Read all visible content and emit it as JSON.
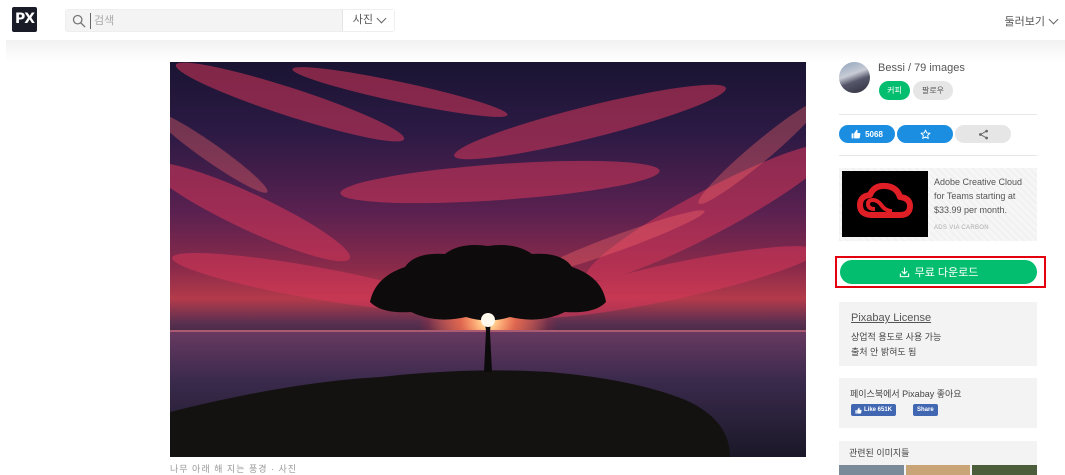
{
  "header": {
    "logo_text": "PX",
    "search_placeholder": "검색",
    "search_type": "사진",
    "explore_label": "둘러보기"
  },
  "photo": {
    "alt": "sunset tree",
    "caption": "나무 아래 해 지는 풍경 · 사진"
  },
  "user": {
    "name": "Bessi / 79 images",
    "coffee_label": "커피",
    "follow_label": "팔로우"
  },
  "actions": {
    "like_count": "5068"
  },
  "ad": {
    "text": "Adobe Creative Cloud for Teams starting at $33.99 per month.",
    "via": "ADS VIA CARBON"
  },
  "download": {
    "label": "무료 다운로드"
  },
  "license": {
    "title": "Pixabay License",
    "line1": "상업적 용도로 사용 가능",
    "line2": "출처 안 밝혀도 됨"
  },
  "facebook": {
    "text": "페이스북에서 Pixabay 좋아요",
    "like_label": "Like 651K",
    "share_label": "Share"
  },
  "related": {
    "title": "관련된 이미지들"
  },
  "colors": {
    "accent_green": "#02be6e",
    "accent_blue": "#1b8ee1",
    "highlight_red": "#e3000f",
    "facebook_blue": "#4267b2"
  }
}
